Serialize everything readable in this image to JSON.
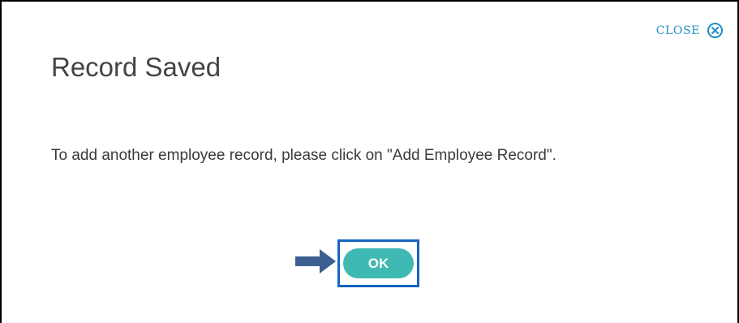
{
  "dialog": {
    "title": "Record Saved",
    "message": "To add another employee record, please click on \"Add Employee Record\".",
    "close_label": "CLOSE",
    "ok_label": "OK"
  },
  "icons": {
    "close": "close-circle-x-icon",
    "pointer": "right-arrow-icon"
  },
  "colors": {
    "accent": "#1f8fc4",
    "ok_button": "#3fb9b3",
    "highlight_border": "#1565c0",
    "arrow": "#3d5e92"
  }
}
